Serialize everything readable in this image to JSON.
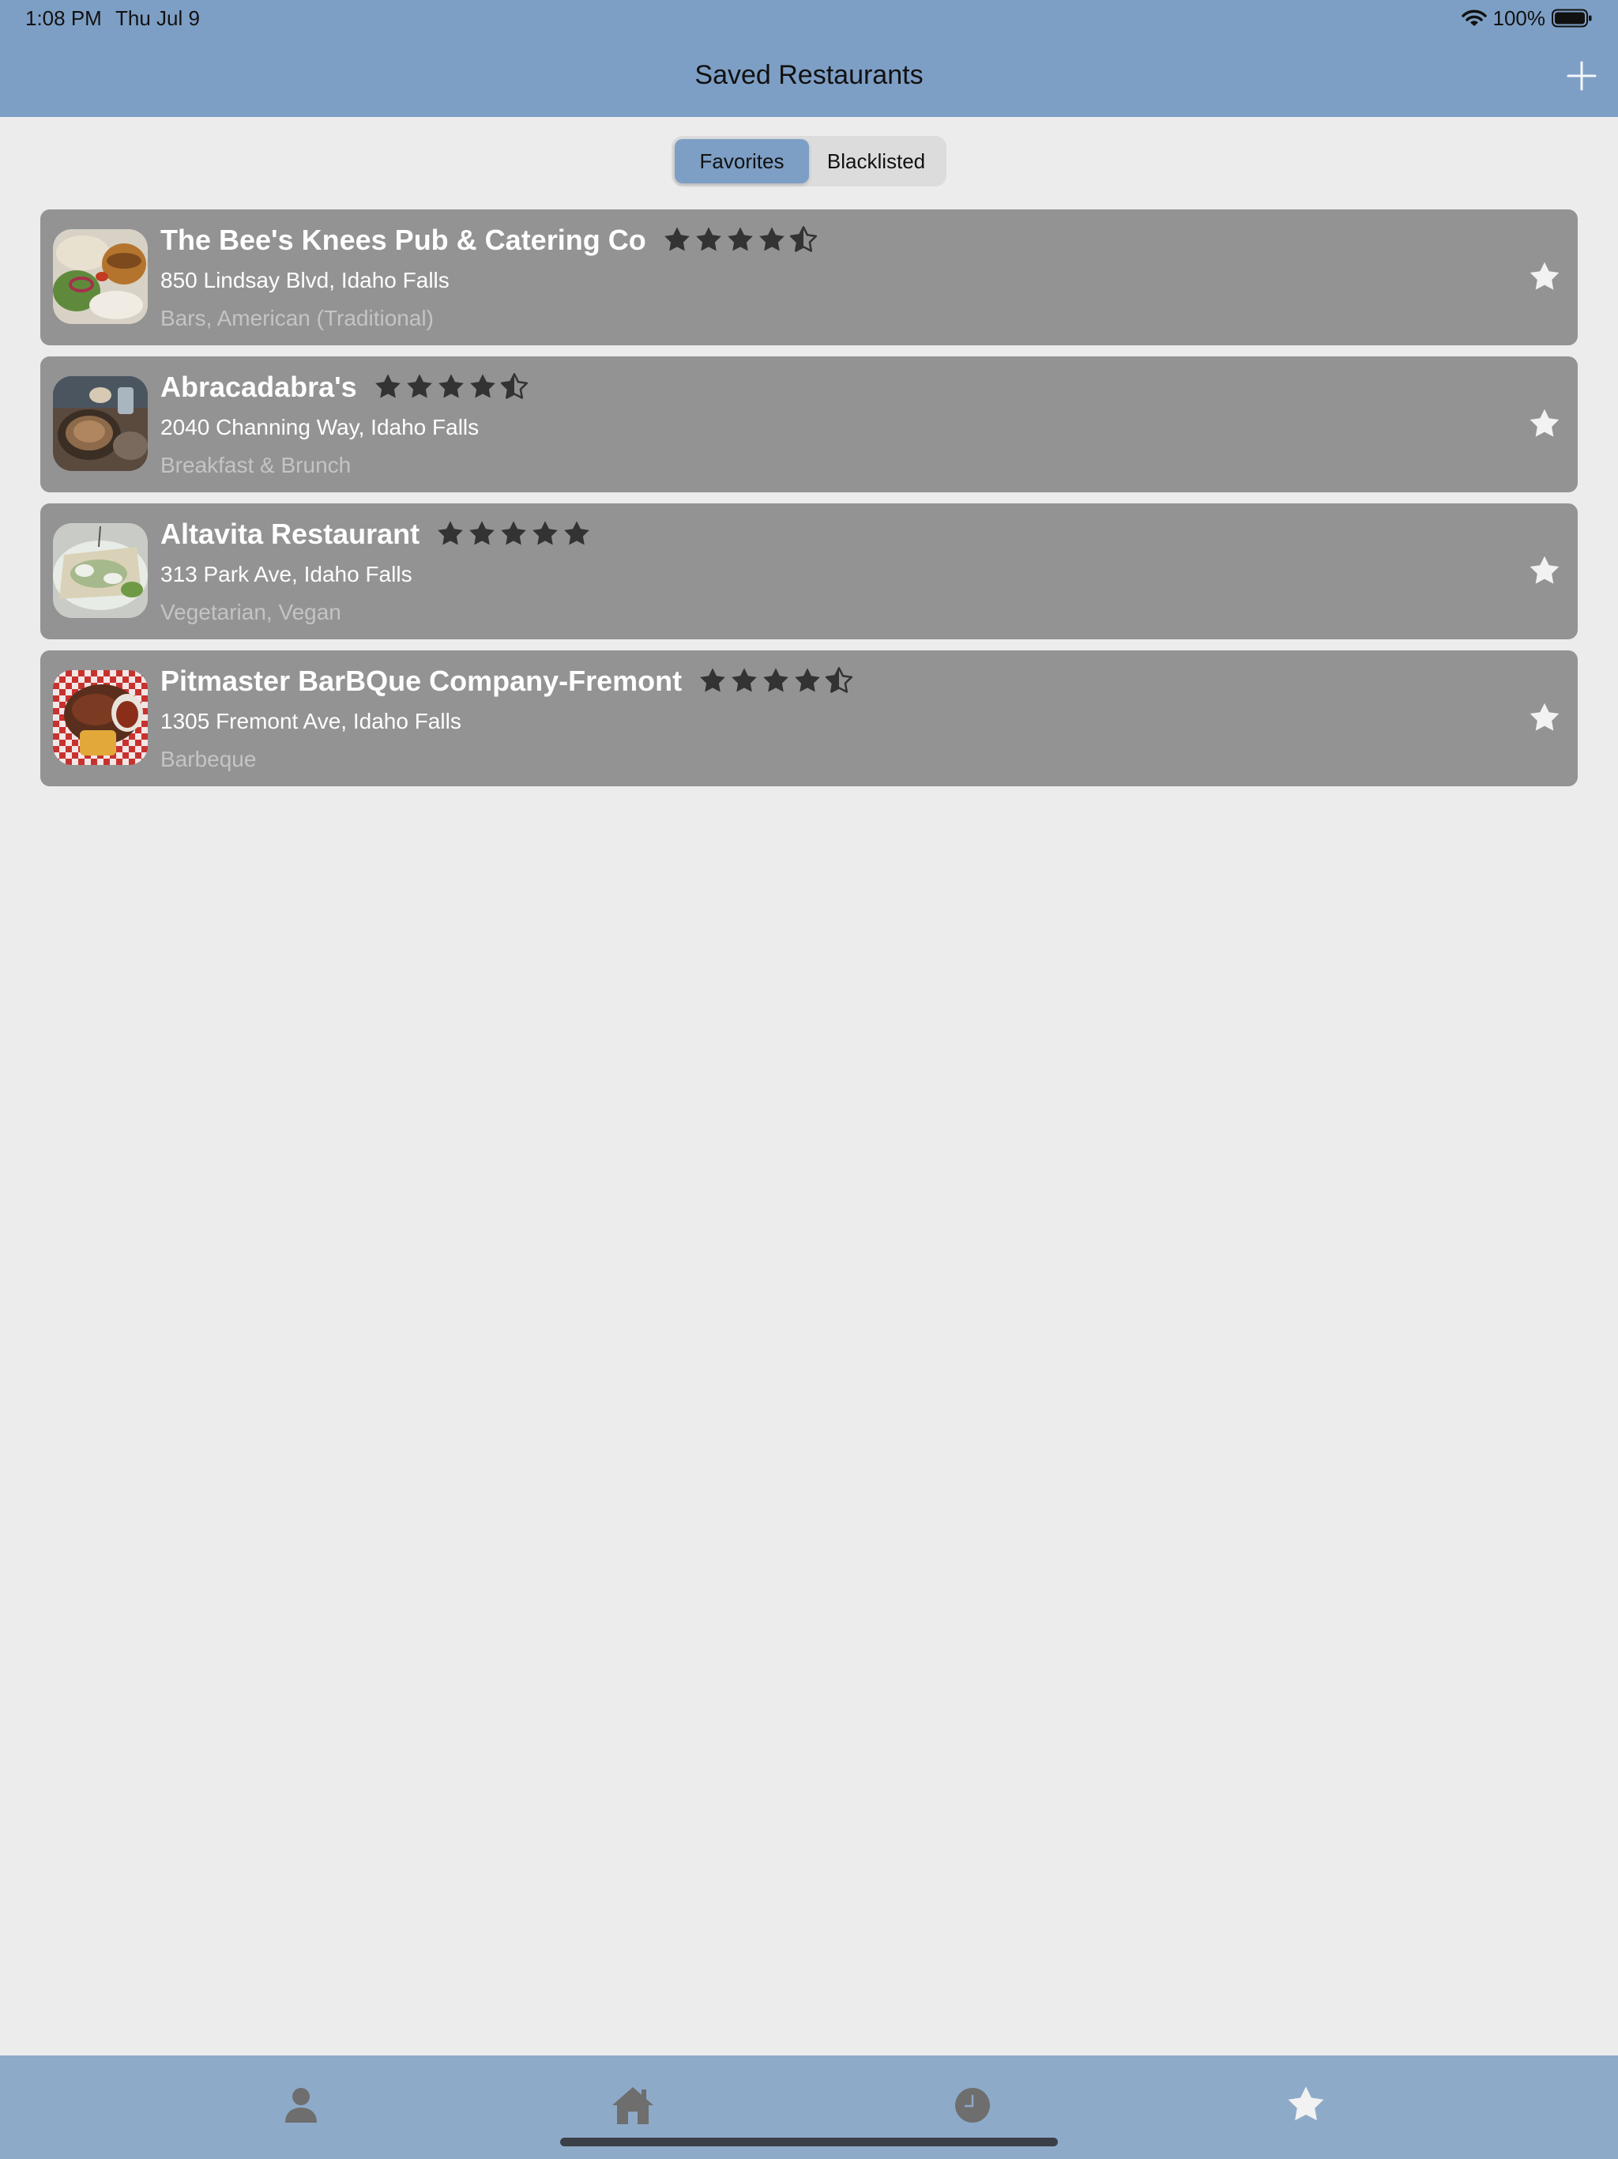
{
  "status_bar": {
    "time": "1:08 PM",
    "date": "Thu Jul 9",
    "battery": "100%",
    "wifi_icon": "wifi-icon",
    "battery_icon": "battery-icon"
  },
  "header": {
    "title": "Saved Restaurants",
    "add_icon": "plus-icon"
  },
  "segmented": {
    "options": [
      "Favorites",
      "Blacklisted"
    ],
    "selected": "Favorites"
  },
  "restaurants": [
    {
      "name": "The Bee's Knees Pub & Catering Co",
      "rating": 4.5,
      "address": "850 Lindsay Blvd, Idaho Falls",
      "categories": "Bars, American (Traditional)",
      "favorited": true
    },
    {
      "name": "Abracadabra's",
      "rating": 4.5,
      "address": "2040 Channing Way, Idaho Falls",
      "categories": "Breakfast & Brunch",
      "favorited": true
    },
    {
      "name": "Altavita Restaurant",
      "rating": 5,
      "address": "313 Park Ave, Idaho Falls",
      "categories": "Vegetarian, Vegan",
      "favorited": true
    },
    {
      "name": "Pitmaster BarBQue Company-Fremont",
      "rating": 4.5,
      "address": "1305 Fremont Ave, Idaho Falls",
      "categories": "Barbeque",
      "favorited": true
    }
  ],
  "tab_bar": {
    "tabs": [
      {
        "icon": "person-icon",
        "selected": false
      },
      {
        "icon": "home-icon",
        "selected": false
      },
      {
        "icon": "clock-icon",
        "selected": false
      },
      {
        "icon": "star-icon",
        "selected": true
      }
    ]
  },
  "colors": {
    "header_bg": "#7e9fc5",
    "tabbar_bg": "#8eaac9",
    "card_bg": "#939393",
    "page_bg": "#ececec",
    "star_dark": "#333333",
    "star_light": "#f2f2f2",
    "tab_icon": "#6e6e6e"
  }
}
